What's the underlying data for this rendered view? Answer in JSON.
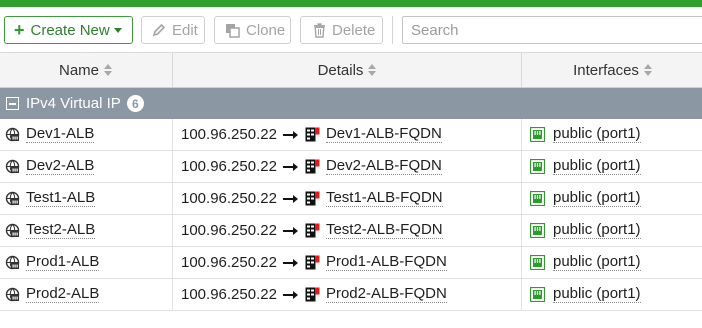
{
  "colors": {
    "accent_green": "#2ea02e",
    "group_header_bg": "#8b98a4"
  },
  "toolbar": {
    "create_label": "Create New",
    "edit_label": "Edit",
    "clone_label": "Clone",
    "delete_label": "Delete",
    "search_placeholder": "Search"
  },
  "table": {
    "columns": [
      "Name",
      "Details",
      "Interfaces"
    ],
    "group": {
      "label": "IPv4 Virtual IP",
      "count": "6"
    },
    "rows": [
      {
        "name": "Dev1-ALB",
        "ip": "100.96.250.22",
        "target": "Dev1-ALB-FQDN",
        "interface": "public (port1)"
      },
      {
        "name": "Dev2-ALB",
        "ip": "100.96.250.22",
        "target": "Dev2-ALB-FQDN",
        "interface": "public (port1)"
      },
      {
        "name": "Test1-ALB",
        "ip": "100.96.250.22",
        "target": "Test1-ALB-FQDN",
        "interface": "public (port1)"
      },
      {
        "name": "Test2-ALB",
        "ip": "100.96.250.22",
        "target": "Test2-ALB-FQDN",
        "interface": "public (port1)"
      },
      {
        "name": "Prod1-ALB",
        "ip": "100.96.250.22",
        "target": "Prod1-ALB-FQDN",
        "interface": "public (port1)"
      },
      {
        "name": "Prod2-ALB",
        "ip": "100.96.250.22",
        "target": "Prod2-ALB-FQDN",
        "interface": "public (port1)"
      }
    ]
  },
  "icons": {
    "create": "plus-icon",
    "edit": "pencil-icon",
    "clone": "clone-icon",
    "delete": "trash-icon",
    "row_name": "virtual-ip-icon",
    "details_arrow": "arrow-right-icon",
    "details_target": "fqdn-address-icon",
    "interface": "port-icon"
  }
}
